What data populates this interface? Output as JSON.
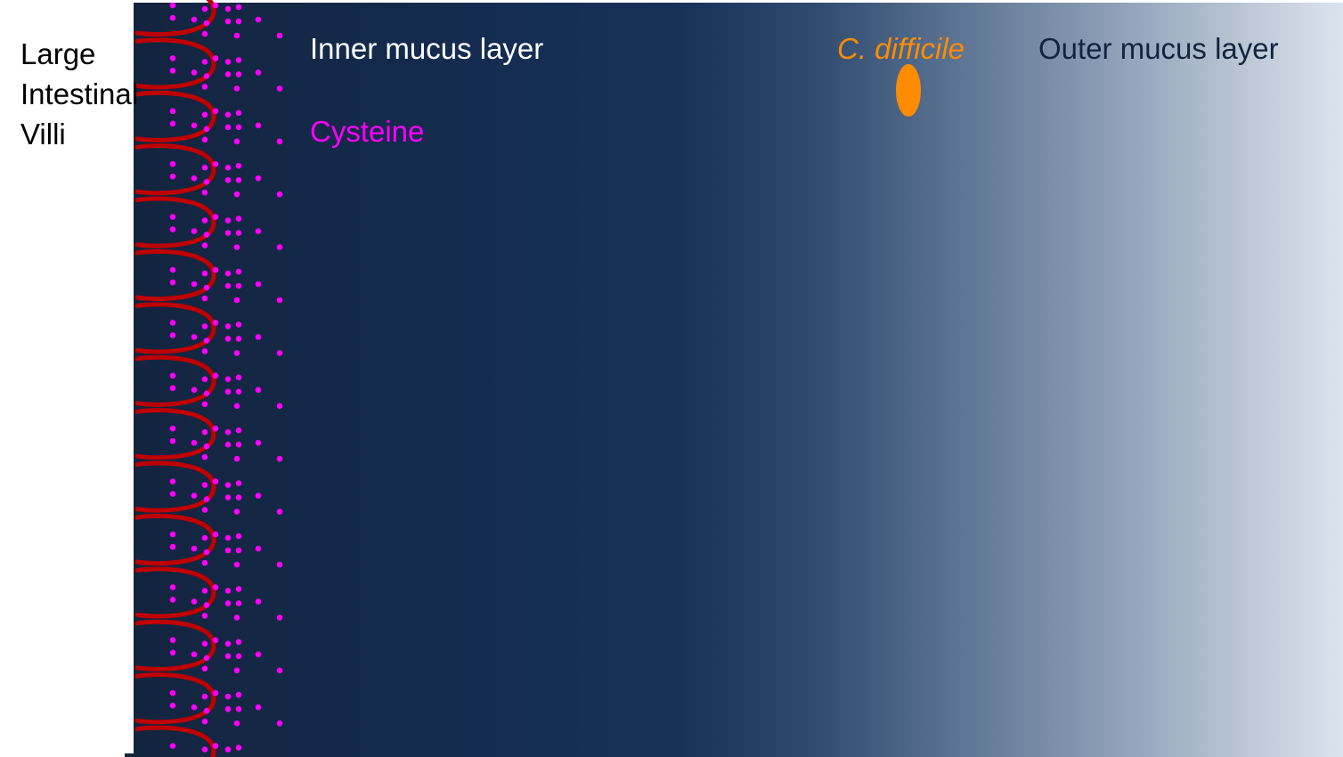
{
  "labels": {
    "villi_lines": [
      "Large",
      "Intestinal",
      "Villi"
    ],
    "inner_mucus": "Inner mucus layer",
    "cysteine": "Cysteine",
    "c_difficile": "C. difficile",
    "outer_mucus": "Outer mucus layer"
  },
  "colors": {
    "villi": "#c00000",
    "cysteine": "#ff00ff",
    "c_difficile": "#ff8c00",
    "inner_mucus": "#13243f",
    "outer_mucus": "#dbe3ee"
  },
  "icons": {
    "villus": "villus-loop-icon",
    "cysteine": "cysteine-dot-icon",
    "c_difficile": "c-difficile-cell-icon"
  }
}
